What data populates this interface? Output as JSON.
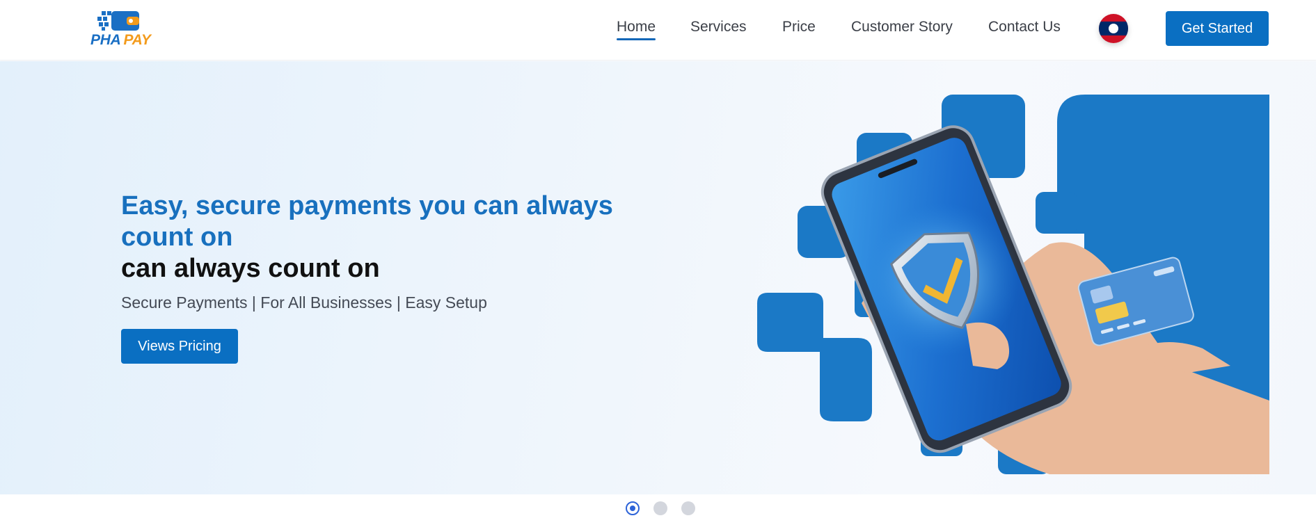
{
  "brand": {
    "name_part1": "PHA",
    "name_part2": "PAY",
    "primary_color": "#0a6fc2",
    "accent_color": "#f39b1c"
  },
  "nav": {
    "items": [
      {
        "label": "Home",
        "active": true
      },
      {
        "label": "Services",
        "active": false
      },
      {
        "label": "Price",
        "active": false
      },
      {
        "label": "Customer Story",
        "active": false
      },
      {
        "label": "Contact Us",
        "active": false
      }
    ],
    "language_icon": "laos-flag-icon",
    "cta_label": "Get Started"
  },
  "hero": {
    "title_line_1": "Easy, secure payments you can always count on",
    "title_line_2": "can always count on",
    "subtitle": "Secure Payments | For All Businesses | Easy Setup",
    "button_label": "Views Pricing",
    "image_icon": "phone-shield-card-illustration"
  },
  "carousel": {
    "slide_count": 3,
    "active_index": 0
  }
}
